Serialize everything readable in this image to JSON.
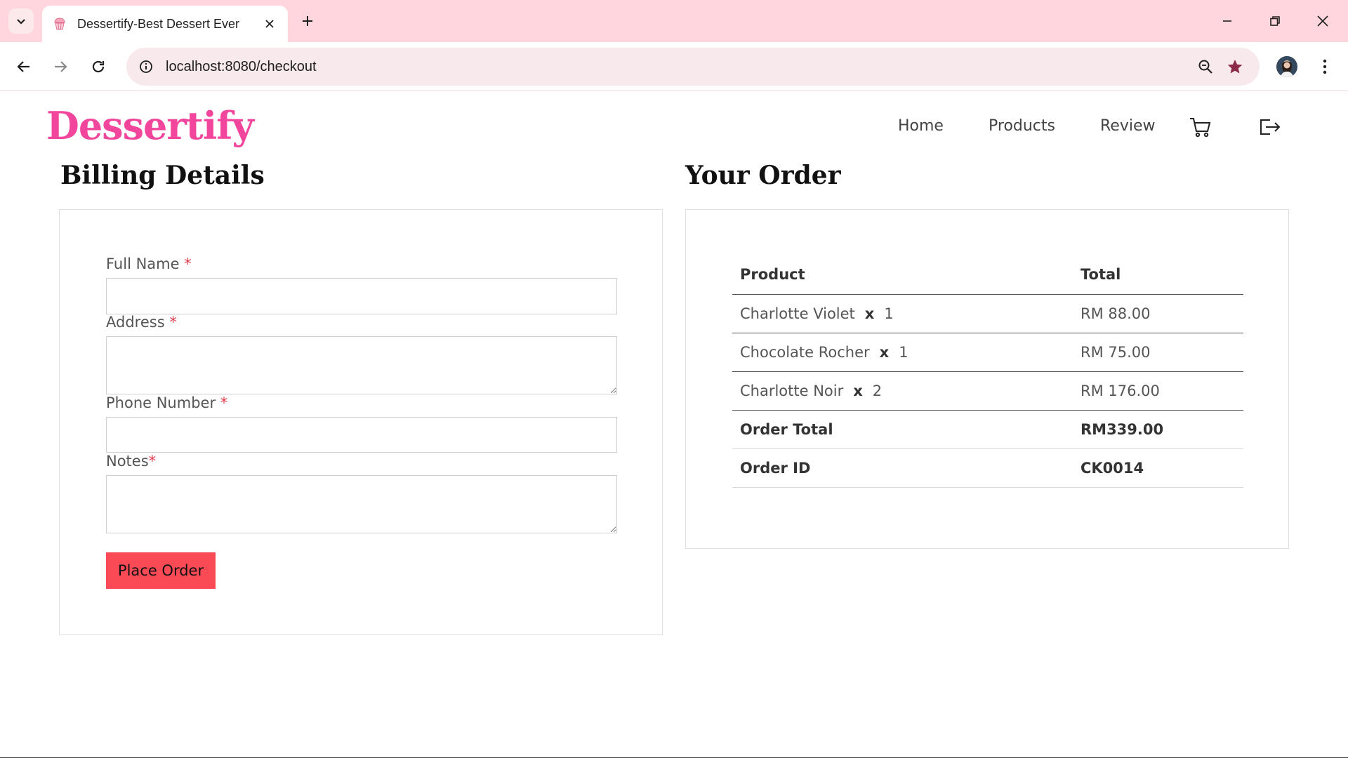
{
  "browser": {
    "tab_title": "Dessertify-Best Dessert Ever",
    "url": "localhost:8080/checkout"
  },
  "site": {
    "logo": "Dessertify",
    "nav": {
      "home": "Home",
      "products": "Products",
      "review": "Review"
    }
  },
  "billing": {
    "title": "Billing Details",
    "full_name_label": "Full Name ",
    "address_label": "Address ",
    "phone_label": "Phone Number ",
    "notes_label": "Notes",
    "required_mark": "*",
    "full_name_value": "",
    "address_value": "",
    "phone_value": "",
    "notes_value": "",
    "place_order_label": "Place Order"
  },
  "order": {
    "title": "Your Order",
    "headers": {
      "product": "Product",
      "total": "Total"
    },
    "items": [
      {
        "name": "Charlotte Violet",
        "times": "x",
        "qty": "1",
        "total": "RM 88.00"
      },
      {
        "name": "Chocolate Rocher",
        "times": "x",
        "qty": "1",
        "total": "RM 75.00"
      },
      {
        "name": "Charlotte Noir",
        "times": "x",
        "qty": "2",
        "total": "RM 176.00"
      }
    ],
    "order_total_label": "Order Total",
    "order_total_value": "RM339.00",
    "order_id_label": "Order ID",
    "order_id_value": "CK0014"
  },
  "colors": {
    "tabbar_bg": "#ffd6dd",
    "logo": "#f2469c",
    "button": "#fa4a55",
    "required": "#e03c4b"
  }
}
